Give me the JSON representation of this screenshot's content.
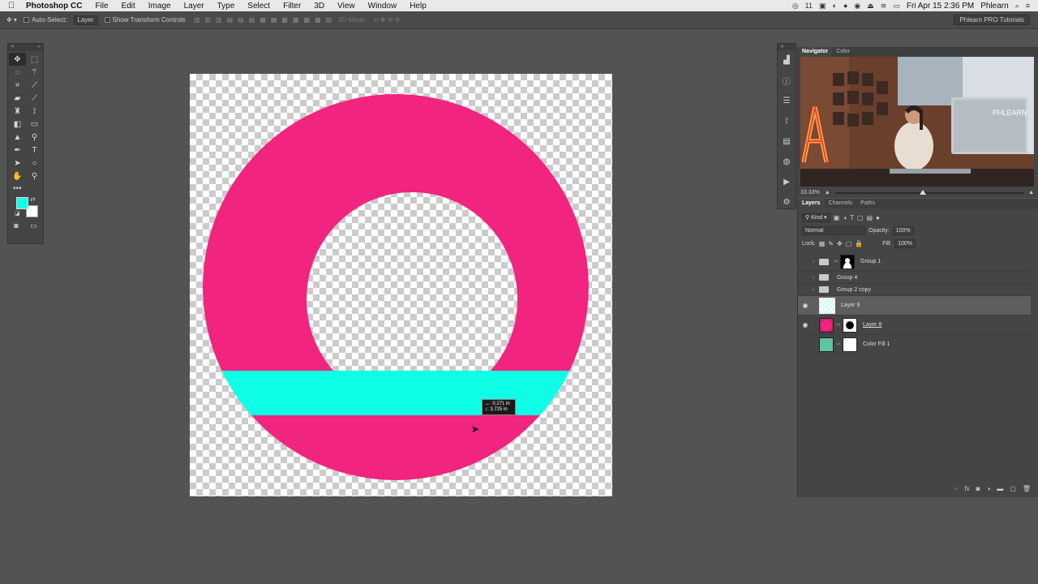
{
  "menubar": {
    "app_name": "Photoshop CC",
    "items": [
      "File",
      "Edit",
      "Image",
      "Layer",
      "Type",
      "Select",
      "Filter",
      "3D",
      "View",
      "Window",
      "Help"
    ],
    "badge_count": "11",
    "clock": "Fri Apr 15  2:36 PM",
    "user": "Phlearn"
  },
  "options": {
    "auto_select_label": "Auto-Select:",
    "auto_select_value": "Layer",
    "transform_label": "Show Transform Controls",
    "mode_3d": "3D Mode:",
    "workspace": "Phlearn PRO Tutorials"
  },
  "tools": {
    "foreground_color": "#0effe6",
    "background_color": "#ffffff"
  },
  "canvas": {
    "tooltip_line1": "↔: 0.271 in",
    "tooltip_line2": "↕: 3.725 in",
    "ring_color": "#f1247f",
    "band_color": "#0effe6"
  },
  "navigator": {
    "tabs": [
      "Navigator",
      "Color"
    ],
    "zoom": "33.33%",
    "photo_sign": "PHLEARN"
  },
  "layers": {
    "tabs": [
      "Layers",
      "Channels",
      "Paths"
    ],
    "filter_kind": "Kind",
    "blend_mode": "Normal",
    "opacity_label": "Opacity:",
    "opacity_value": "100%",
    "lock_label": "Lock:",
    "fill_label": "Fill:",
    "fill_value": "100%",
    "items": [
      {
        "name": "Group 1"
      },
      {
        "name": "Group 4"
      },
      {
        "name": "Group 2 copy"
      },
      {
        "name": "Layer 9"
      },
      {
        "name": "Layer 8"
      },
      {
        "name": "Color Fill 1"
      }
    ]
  }
}
